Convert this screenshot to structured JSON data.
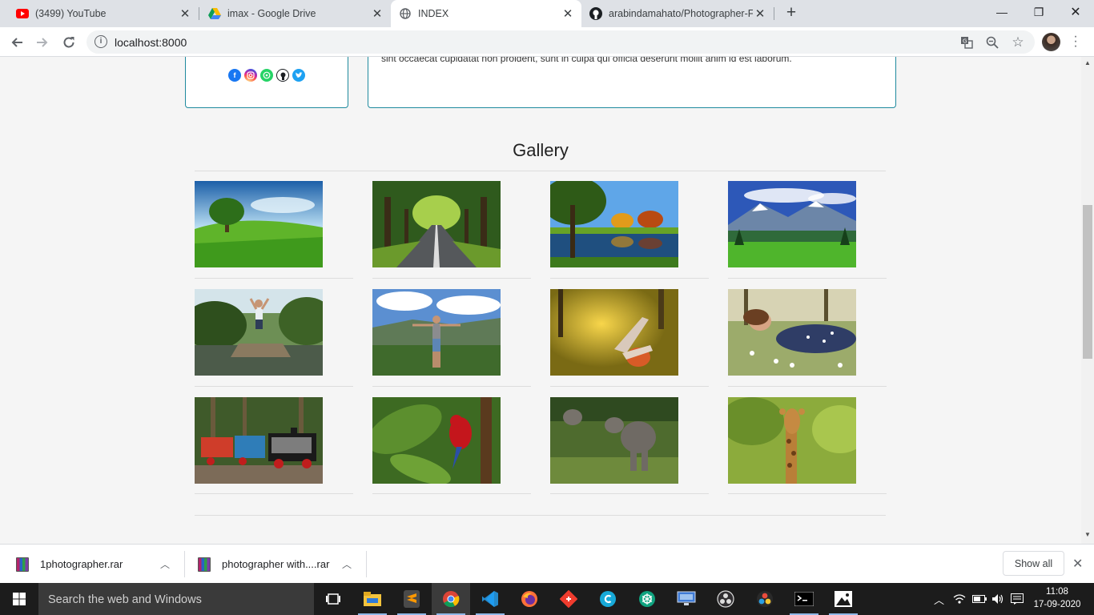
{
  "browser": {
    "tabs": [
      {
        "label": "(3499) YouTube",
        "icon": "youtube-icon"
      },
      {
        "label": "imax - Google Drive",
        "icon": "google-drive-icon"
      },
      {
        "label": "INDEX",
        "icon": "globe-icon",
        "active": true
      },
      {
        "label": "arabindamahato/Photographer-F",
        "icon": "github-icon"
      }
    ],
    "new_tab": "+",
    "url": "localhost:8000",
    "window_controls": {
      "minimize": "—",
      "restore": "❐",
      "close": "✕"
    }
  },
  "page": {
    "about_text": "sint occaecat cupidatat non proident, sunt in culpa qui officia deserunt mollit anim id est laborum.",
    "social_icons": [
      "facebook-icon",
      "instagram-icon",
      "whatsapp-icon",
      "github-icon",
      "twitter-icon"
    ],
    "gallery_title": "Gallery",
    "gallery_images": [
      {
        "name": "green-field-tree",
        "scene": "landscape"
      },
      {
        "name": "tree-lined-road",
        "scene": "landscape"
      },
      {
        "name": "lake-autumn-trees",
        "scene": "landscape"
      },
      {
        "name": "mountain-valley",
        "scene": "landscape"
      },
      {
        "name": "person-jumping-dock",
        "scene": "people"
      },
      {
        "name": "man-on-cliff",
        "scene": "people"
      },
      {
        "name": "person-lying-grass",
        "scene": "people"
      },
      {
        "name": "woman-in-flowers",
        "scene": "people"
      },
      {
        "name": "toy-train",
        "scene": "object"
      },
      {
        "name": "red-parrot",
        "scene": "animal"
      },
      {
        "name": "elephants",
        "scene": "animal"
      },
      {
        "name": "giraffe",
        "scene": "animal"
      }
    ]
  },
  "downloads": {
    "items": [
      {
        "name": "1photographer.rar"
      },
      {
        "name": "photographer with....rar"
      }
    ],
    "show_all": "Show all"
  },
  "taskbar": {
    "search_placeholder": "Search the web and Windows",
    "apps": [
      "task-view-icon",
      "file-explorer-icon",
      "sublime-text-icon",
      "chrome-icon",
      "vscode-icon",
      "firefox-icon",
      "git-icon",
      "canva-icon",
      "chatgpt-icon",
      "network-icon",
      "obs-icon",
      "davinci-resolve-icon",
      "terminal-icon",
      "photos-icon"
    ],
    "time": "11:08",
    "date": "17-09-2020"
  },
  "colors": {
    "accent": "#1f8a9e",
    "page_bg": "#f5f5f5",
    "taskbar": "#1c1c1c"
  }
}
